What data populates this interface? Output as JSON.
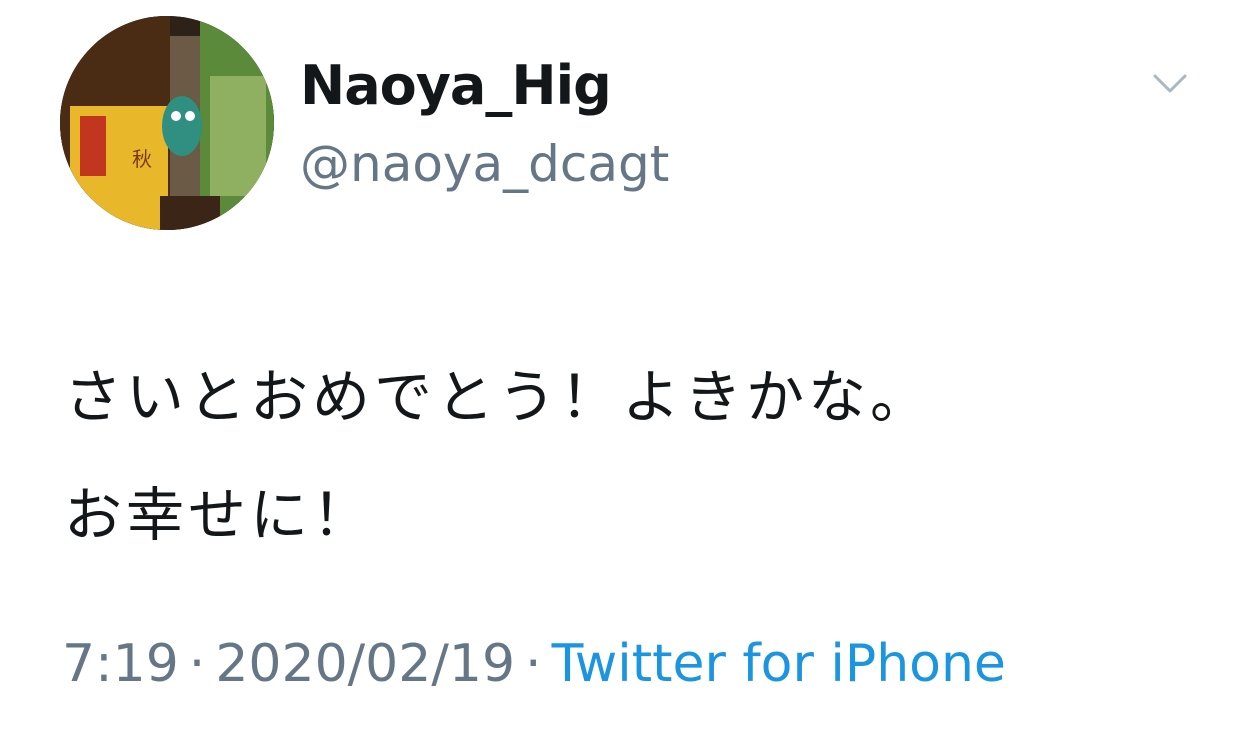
{
  "tweet": {
    "display_name": "Naoya_Hig",
    "handle": "@naoya_dcagt",
    "text_lines": [
      "さいとおめでとう！よきかな。",
      "お幸せに！"
    ],
    "time": "7:19",
    "separator": "·",
    "date": "2020/02/19",
    "source": "Twitter for iPhone"
  },
  "icons": {
    "menu": "chevron-down-icon"
  },
  "colors": {
    "text": "#14171a",
    "secondary": "#657786",
    "link": "#1b95e0",
    "chevron": "#aab8c2"
  }
}
